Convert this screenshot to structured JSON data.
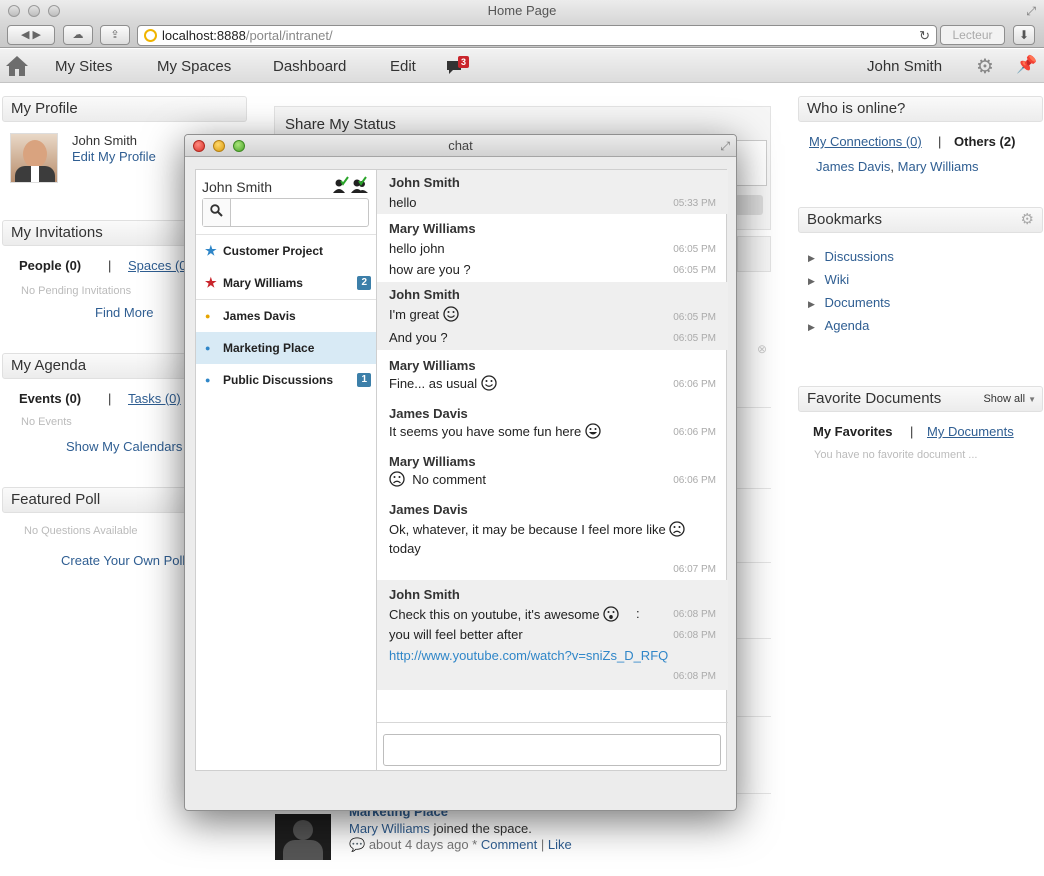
{
  "browser": {
    "window_title": "Home Page",
    "url_host": "localhost:8888",
    "url_path": "/portal/intranet/",
    "reader_label": "Lecteur"
  },
  "nav": {
    "my_sites": "My Sites",
    "my_spaces": "My Spaces",
    "dashboard": "Dashboard",
    "edit": "Edit",
    "chat_count": "3",
    "user": "John Smith"
  },
  "profile": {
    "title": "My Profile",
    "name": "John Smith",
    "edit_link": "Edit My Profile"
  },
  "invitations": {
    "title": "My Invitations",
    "people_tab": "People (0)",
    "separator": "|",
    "spaces_tab": "Spaces (0)",
    "empty": "No Pending Invitations",
    "find_more": "Find More"
  },
  "agenda": {
    "title": "My Agenda",
    "events_tab": "Events (0)",
    "separator": "|",
    "tasks_tab": "Tasks (0)",
    "empty": "No Events",
    "show_calendars": "Show My Calendars"
  },
  "poll": {
    "title": "Featured Poll",
    "empty": "No Questions Available",
    "create": "Create Your Own Poll"
  },
  "status": {
    "title": "Share My Status"
  },
  "activity": {
    "space_name": "Marketing Place",
    "user": "Mary Williams",
    "action": "joined the space.",
    "time": "about 4 days ago *",
    "comment": "Comment",
    "separator": "|",
    "like": "Like"
  },
  "online": {
    "title": "Who is online?",
    "connections_tab": "My Connections (0)",
    "separator": "|",
    "others_tab": "Others (2)",
    "user_a": "James Davis",
    "comma": ",",
    "user_b": "Mary Williams"
  },
  "bookmarks": {
    "title": "Bookmarks",
    "items": [
      "Discussions",
      "Wiki",
      "Documents",
      "Agenda"
    ]
  },
  "fav_docs": {
    "title": "Favorite Documents",
    "show_all": "Show all",
    "my_favorites": "My Favorites",
    "separator": "|",
    "my_documents": "My Documents",
    "empty": "You have no favorite document ..."
  },
  "chat": {
    "window_title": "chat",
    "user": "John Smith",
    "contacts": [
      {
        "name": "Customer Project",
        "mark": "★",
        "color": "#2f86c8",
        "badge": ""
      },
      {
        "name": "Mary Williams",
        "mark": "★",
        "color": "#c9252c",
        "badge": "2"
      },
      {
        "name": "James Davis",
        "mark": "●",
        "color": "#e6a400",
        "badge": ""
      },
      {
        "name": "Marketing Place",
        "mark": "●",
        "color": "#2f86c8",
        "badge": ""
      },
      {
        "name": "Public Discussions",
        "mark": "●",
        "color": "#2f86c8",
        "badge": "1"
      }
    ],
    "messages": [
      {
        "author": "John Smith",
        "lines": [
          {
            "text": "hello",
            "time": "05:33 PM"
          }
        ]
      },
      {
        "author": "Mary Williams",
        "lines": [
          {
            "text": "hello john",
            "time": "06:05 PM"
          },
          {
            "text": "how are you ?",
            "time": "06:05 PM"
          }
        ]
      },
      {
        "author": "John Smith",
        "lines": [
          {
            "text": "I'm great",
            "time": "06:05 PM"
          },
          {
            "text": "And you ?",
            "time": "06:05 PM"
          }
        ]
      },
      {
        "author": "Mary Williams",
        "lines": [
          {
            "text": "Fine... as usual",
            "time": "06:06 PM"
          }
        ]
      },
      {
        "author": "James Davis",
        "lines": [
          {
            "text": "It seems you have some fun here",
            "time": "06:06 PM"
          }
        ]
      },
      {
        "author": "Mary Williams",
        "lines": [
          {
            "text": "No comment",
            "time": "06:06 PM"
          }
        ]
      },
      {
        "author": "James Davis",
        "lines": [
          {
            "text": "Ok, whatever, it may be because I feel more like",
            "time": ""
          },
          {
            "text": "today",
            "time": "06:07 PM"
          }
        ]
      },
      {
        "author": "John Smith",
        "lines": [
          {
            "text": "Check this on youtube, it's awesome",
            "time": "06:08 PM"
          },
          {
            "text": ":",
            "time": ""
          },
          {
            "text": "you will feel better after",
            "time": "06:08 PM"
          },
          {
            "text": "http://www.youtube.com/watch?v=sniZs_D_RFQ",
            "time": "06:08 PM"
          }
        ]
      }
    ]
  }
}
